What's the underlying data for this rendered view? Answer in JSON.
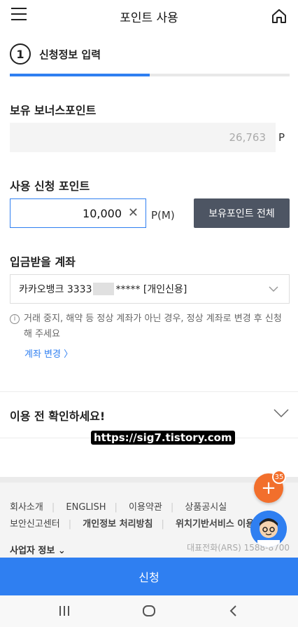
{
  "header": {
    "title": "포인트 사용",
    "menu_icon": "hamburger-menu-icon",
    "home_icon": "home-icon"
  },
  "step": {
    "number": "1",
    "label": "신청정보 입력",
    "progress_fraction": 0.5
  },
  "bonus": {
    "label": "보유 보너스포인트",
    "value": "26,763",
    "unit": "P"
  },
  "apply": {
    "label": "사용 신청 포인트",
    "value": "10,000",
    "unit": "P(M)",
    "all_button": "보유포인트 전체",
    "clear_icon": "clear-icon"
  },
  "account": {
    "label": "입금받을 계좌",
    "bank_prefix": "카카오뱅크 3333",
    "bank_suffix": "***** [개인신용]",
    "notice": "거래 중지, 해약 등 정상 계좌가 아닌 경우, 정상 계좌로 변경 후 신청해 주세요",
    "change_link": "계좌 변경 〉"
  },
  "confirm": {
    "label": "이용 전 확인하세요!"
  },
  "watermark": "https://sig7.tistory.com",
  "footer": {
    "row1": [
      "회사소개",
      "ENGLISH",
      "이용약관",
      "상품공시실"
    ],
    "row2": [
      "보안신고센터",
      "개인정보 처리방침",
      "위치기반서비스 이용약관"
    ],
    "biz_info": "사업자 정보",
    "tel": "대표전화(ARS) 1588-8700"
  },
  "fab": {
    "badge": "35",
    "label": "+"
  },
  "submit": {
    "label": "신청"
  },
  "colors": {
    "accent": "#2f7ff1",
    "fab": "#f26f2c",
    "button_dark": "#4d5563"
  }
}
